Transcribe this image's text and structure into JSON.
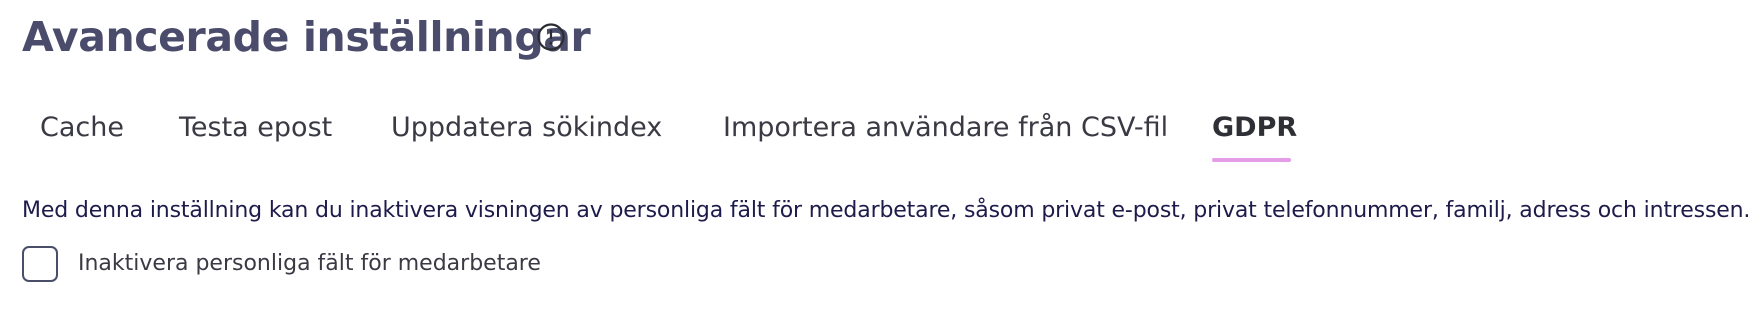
{
  "header": {
    "title": "Avancerade inställningar",
    "info_icon": "info-circle-icon"
  },
  "tabs": [
    {
      "label": "Cache",
      "active": false
    },
    {
      "label": "Testa epost",
      "active": false
    },
    {
      "label": "Uppdatera sökindex",
      "active": false
    },
    {
      "label": "Importera användare från CSV-fil",
      "active": false
    },
    {
      "label": "GDPR",
      "active": true
    }
  ],
  "gdpr": {
    "description": "Med denna inställning kan du inaktivera visningen av personliga fält för medarbetare, såsom privat e-post, privat telefonnummer, familj, adress och intressen.",
    "checkbox_label": "Inaktivera personliga fält för medarbetare",
    "checkbox_checked": false
  },
  "colors": {
    "title": "#4b4c6b",
    "tab_text": "#3a3a44",
    "tab_active_text": "#2f2f36",
    "tab_indicator": "#e59be6",
    "description_text": "#1e1b4b",
    "checkbox_label_text": "#3a3a44"
  }
}
